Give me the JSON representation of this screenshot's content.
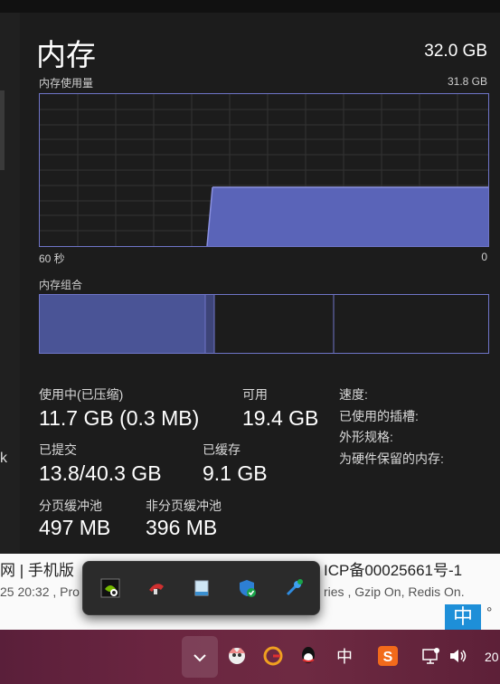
{
  "memory": {
    "title": "内存",
    "total": "32.0 GB",
    "usage_label": "内存使用量",
    "usage_max": "31.8 GB",
    "time_label": "60 秒",
    "time_end": "0",
    "composition_label": "内存组合"
  },
  "stats": {
    "in_use_label": "使用中(已压缩)",
    "in_use_value": "11.7 GB (0.3 MB)",
    "available_label": "可用",
    "available_value": "19.4 GB",
    "committed_label": "已提交",
    "committed_value": "13.8/40.3 GB",
    "cached_label": "已缓存",
    "cached_value": "9.1 GB",
    "paged_pool_label": "分页缓冲池",
    "paged_pool_value": "497 MB",
    "nonpaged_pool_label": "非分页缓冲池",
    "nonpaged_pool_value": "396 MB"
  },
  "details": {
    "speed_label": "速度:",
    "slots_label": "已使用的插槽:",
    "form_factor_label": "外形规格:",
    "reserved_label": "为硬件保留的内存:"
  },
  "background_web": {
    "line1_left": "网 | 手机版",
    "line1_right": "ICP备00025661号-1",
    "line2_left": "25 20:32 , Pro",
    "line2_right": "ries , Gzip On, Redis On."
  },
  "left_fragment": "k",
  "ime_indicator": "中",
  "ime_degree": "°",
  "tray_icons": [
    "nvidia-icon",
    "red-app-icon",
    "display-icon",
    "defender-icon",
    "network-tool-icon"
  ],
  "taskbar": {
    "items": [
      "chevron-up-icon",
      "avatar-icon",
      "g-app-icon",
      "qq-icon"
    ],
    "ime": "中",
    "sogou": "S",
    "clock": "20"
  },
  "colors": {
    "accent": "#6f75c8",
    "fill": "#5a64b8",
    "taskbar": "#6a2540"
  }
}
